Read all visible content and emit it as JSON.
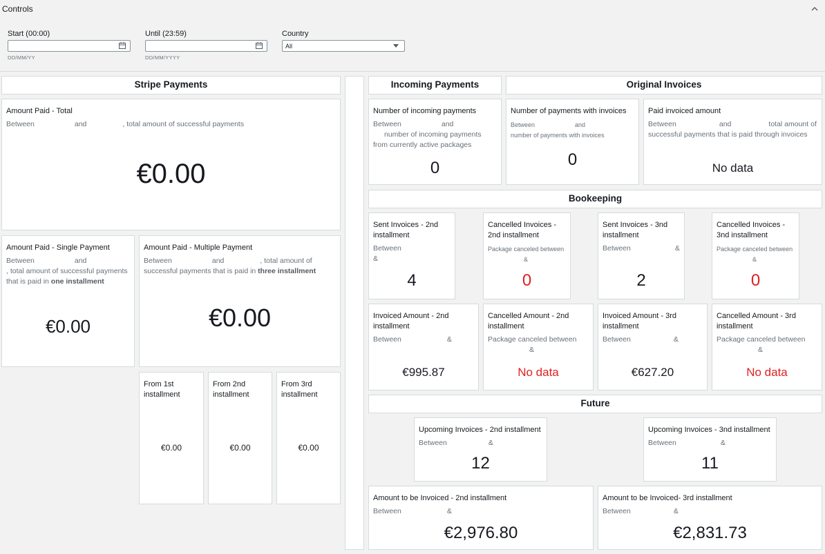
{
  "controls": {
    "title": "Controls",
    "start": {
      "label": "Start (00:00)",
      "hint": "DD/MM/YY"
    },
    "until": {
      "label": "Until (23:59)",
      "hint": "DD/MM/YYYY"
    },
    "country": {
      "label": "Country",
      "value": "All"
    }
  },
  "headers": {
    "stripe": "Stripe Payments",
    "incoming": "Incoming Payments",
    "original": "Original Invoices",
    "bookkeeping": "Bookeeping",
    "future": "Future"
  },
  "stripe": {
    "total": {
      "title": "Amount Paid - Total",
      "sub_a": "Between",
      "sub_b": "and",
      "sub_c": ", total amount of successful payments",
      "value": "€0.00"
    },
    "single": {
      "title": "Amount Paid - Single Payment",
      "sub_a": "Between",
      "sub_b": "and",
      "sub_c": ", total amount of successful payments that is paid in ",
      "sub_bold": "one installment",
      "value": "€0.00"
    },
    "multiple": {
      "title": "Amount Paid - Multiple Payment",
      "sub_a": "Between",
      "sub_b": "and",
      "sub_c": ", total amount of successful payments that is paid in ",
      "sub_bold": "three installment",
      "value": "€0.00"
    },
    "from1": {
      "title": "From 1st installment",
      "value": "€0.00"
    },
    "from2": {
      "title": "From 2nd installment",
      "value": "€0.00"
    },
    "from3": {
      "title": "From 3rd installment",
      "value": "€0.00"
    }
  },
  "incoming": {
    "count": {
      "title": "Number of incoming payments",
      "sub_a": "Between",
      "sub_b": "and",
      "sub_c": "number of incoming payments from currently active packages",
      "value": "0"
    },
    "with_invoices": {
      "title": "Number of payments with invoices",
      "sub_a": "Between",
      "sub_b": "and",
      "sub_c": "number of payments with invoices",
      "value": "0"
    },
    "paid_invoiced": {
      "title": "Paid invoiced amount",
      "sub_a": "Between",
      "sub_b": "and",
      "sub_c": "total amount of successful payments that is paid through invoices",
      "value": "No data"
    }
  },
  "bookkeeping": {
    "sent2": {
      "title": "Sent Invoices - 2nd installment",
      "sub_a": "Between",
      "sub_b": "&",
      "value": "4"
    },
    "cancel2": {
      "title": "Cancelled Invoices - 2nd installment",
      "sub_a": "Package canceled between",
      "sub_b": "&",
      "value": "0"
    },
    "sent3": {
      "title": "Sent Invoices - 3nd installment",
      "sub_a": "Between",
      "sub_b": "&",
      "value": "2"
    },
    "cancel3": {
      "title": "Cancelled Invoices - 3nd installment",
      "sub_a": "Package canceled between",
      "sub_b": "&",
      "value": "0"
    },
    "inv2": {
      "title": "Invoiced Amount - 2nd installment",
      "sub_a": "Between",
      "sub_b": "&",
      "value": "€995.87"
    },
    "camt2": {
      "title": "Cancelled Amount - 2nd installment",
      "sub_a": "Package canceled between",
      "sub_b": "&",
      "value": "No data"
    },
    "inv3": {
      "title": "Invoiced Amount - 3rd installment",
      "sub_a": "Between",
      "sub_b": "&",
      "value": "€627.20"
    },
    "camt3": {
      "title": "Cancelled Amount - 3rd installment",
      "sub_a": "Package canceled between",
      "sub_b": "&",
      "value": "No data"
    }
  },
  "future": {
    "up2": {
      "title": "Upcoming Invoices - 2nd installment",
      "sub_a": "Between",
      "sub_b": "&",
      "value": "12"
    },
    "up3": {
      "title": "Upcoming Invoices - 3nd installment",
      "sub_a": "Between",
      "sub_b": "&",
      "value": "11"
    },
    "amt2": {
      "title": "Amount to be Invoiced - 2nd installment",
      "sub_a": "Between",
      "sub_b": "&",
      "value": "€2,976.80"
    },
    "amt3": {
      "title": "Amount to be Invoiced- 3rd installment",
      "sub_a": "Between",
      "sub_b": "&",
      "value": "€2,831.73"
    }
  },
  "colors": {
    "alert": "#e02020",
    "border": "#d5dbdb",
    "muted": "#687078"
  },
  "icons": [
    "chevron-up-icon",
    "calendar-icon",
    "caret-down-icon"
  ]
}
